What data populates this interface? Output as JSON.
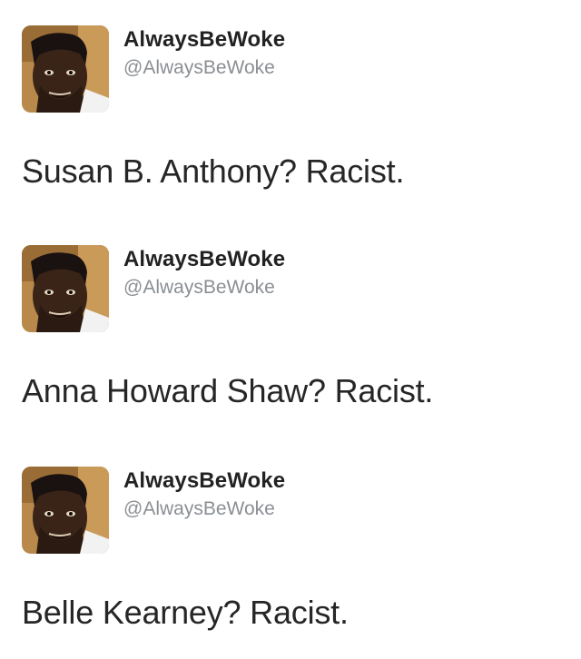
{
  "tweets": [
    {
      "display_name": "AlwaysBeWoke",
      "handle": "@AlwaysBeWoke",
      "text": "Susan B. Anthony? Racist."
    },
    {
      "display_name": "AlwaysBeWoke",
      "handle": "@AlwaysBeWoke",
      "text": "Anna Howard Shaw? Racist."
    },
    {
      "display_name": "AlwaysBeWoke",
      "handle": "@AlwaysBeWoke",
      "text": "Belle Kearney? Racist."
    }
  ],
  "avatar": {
    "icon": "profile-photo",
    "colors": {
      "background": "#b8894a",
      "skin": "#3a2418",
      "hair": "#1a1210",
      "shirt": "#f2f2f2"
    }
  }
}
